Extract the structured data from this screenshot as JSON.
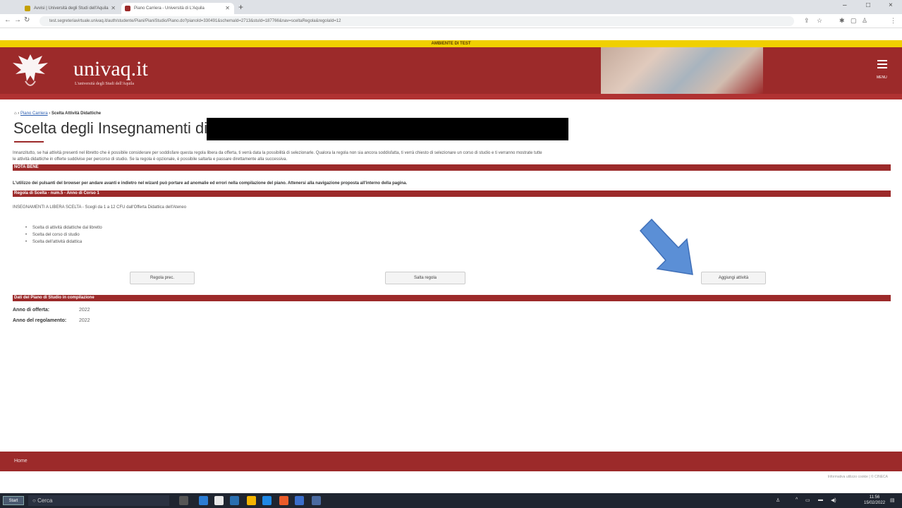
{
  "browser": {
    "tabs": [
      {
        "label": "Avvisi | Università degli Studi dell'Aquila",
        "active": false
      },
      {
        "label": "Piano Carriera - Università di L'Aquila",
        "active": true
      }
    ],
    "new_tab": "+",
    "url": "test.segreteriavirtuale.univaq.it/auth/studente/Piani/PianiStudio/Piano.do?pianoId=330491&schemaId=2713&stuId=187766&nav=sceltaRegola&regolaId=12",
    "window_controls": {
      "minimize": "–",
      "maximize": "□",
      "close": "×"
    }
  },
  "test_banner": "AMBIENTE DI TEST",
  "header": {
    "logo_text": "univaq.it",
    "logo_subtitle": "L'università degli Studi dell'Aquila",
    "menu_label": "MENU"
  },
  "breadcrumb": {
    "home_icon": "home-icon",
    "link": "Piano Carriera",
    "current": "Scelta Attività Didattiche"
  },
  "page_title": "Scelta degli Insegnamenti di:",
  "intro_line1": "Innanzitutto, se hai attività presenti nel libretto che è possibile considerare per soddisfare questa regola libera da offerta, ti verrà data la possibilità di selezionarle. Qualora la regola non sia ancora soddisfatta, ti verrà chiesto di selezionare un corso di studio e ti verranno mostrate tutte",
  "intro_line2": "le attività didattiche in offerte suddivise per percorso di studio. Se la regola è opzionale, è possibile saltarla e passare direttamente alla successiva.",
  "nota_bene": {
    "heading": "NOTA BENE",
    "text": "L'utilizzo dei pulsanti del browser per andare avanti e indietro nel wizard può portare ad anomalie ed errori nella compilazione del piano. Attenersi alla navigazione proposta all'interno della pagina."
  },
  "rule": {
    "heading": "Regola di Scelta - num.5 - Anno di Corso 1",
    "description": "INSEGNAMENTI A LIBERA SCELTA - Scegli da 1 a 12 CFU dall'Offerta Didattica dell'Ateneo",
    "steps": [
      "Scelta di attività didattiche dal libretto",
      "Scelta del corso di studio",
      "Scelta dell'attività didattica"
    ]
  },
  "buttons": {
    "prev": "Regola prec.",
    "skip": "Salta regola",
    "add": "Aggiungi attività"
  },
  "plan_data": {
    "heading": "Dati del Piano di Studio in compilazione",
    "rows": [
      {
        "label": "Anno di offerta:",
        "value": "2022"
      },
      {
        "label": "Anno del regolamento:",
        "value": "2022"
      }
    ]
  },
  "footer": {
    "home": "Home",
    "links": "Informativa utilizzo cookie | © CINECA"
  },
  "taskbar": {
    "start": "Start",
    "search": "Cerca",
    "time": "11:56",
    "date": "15/02/2022"
  },
  "colors": {
    "brand_red": "#9c2a2a",
    "test_banner": "#f0d000",
    "arrow_blue": "#5b8fd6"
  }
}
